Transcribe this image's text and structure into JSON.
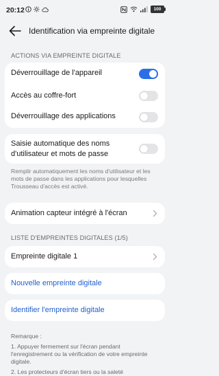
{
  "status_bar": {
    "time": "20:12",
    "battery": "100"
  },
  "header": {
    "title": "Identification via empreinte digitale"
  },
  "actions_section": {
    "title": "ACTIONS VIA EMPREINTE DIGITALE",
    "items": [
      {
        "label": "Déverrouillage de l'appareil",
        "enabled": true
      },
      {
        "label": "Accès au coffre-fort",
        "enabled": false
      },
      {
        "label": "Déverrouillage des applications",
        "enabled": false
      }
    ]
  },
  "autofill": {
    "label_line1": "Saisie automatique des noms",
    "label_line2": "d'utilisateur et mots de passe",
    "enabled": false,
    "description": "Remplir automatiquement les noms d'utilisateur et les mots de passe dans les applications pour lesquelles Trousseau d'accès est activé."
  },
  "animation": {
    "label": "Animation capteur intégré à l'écran"
  },
  "fingerprints_section": {
    "title": "LISTE D'EMPREINTES DIGITALES (1/5)",
    "items": [
      {
        "label": "Empreinte digitale 1"
      }
    ]
  },
  "new_fingerprint": {
    "label": "Nouvelle empreinte digitale"
  },
  "identify_fingerprint": {
    "label": "Identifier l'empreinte digitale"
  },
  "remarks": {
    "title": "Remarque :",
    "items": [
      "1. Appuyer fermement sur l'écran pendant l'enregistrement ou la vérification de votre empreinte digitale.",
      "2. Les protecteurs d'écran tiers ou la saleté"
    ]
  },
  "colors": {
    "accent": "#2c6ee6",
    "link": "#2460cc",
    "background": "#f1f3f5"
  }
}
